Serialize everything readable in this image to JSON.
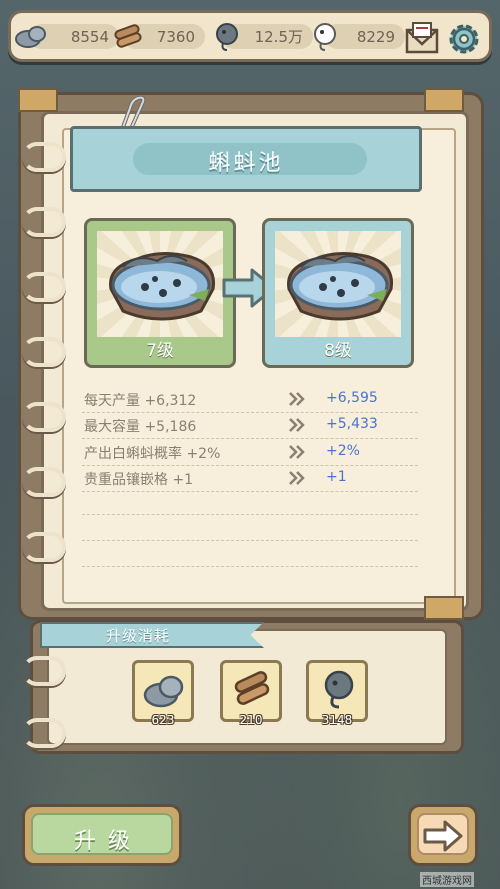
{
  "top_bar": {
    "stone_count": "8554",
    "wood_count": "7360",
    "tadpole_count": "12.5万",
    "ghost_count": "8229",
    "mail_icon": "mail-icon",
    "settings_icon": "gear-icon"
  },
  "building": {
    "title": "蝌蚪池",
    "current_level": "7级",
    "next_level": "8级"
  },
  "stats": [
    {
      "label": "每天产量 +6,312",
      "new": "+6,595"
    },
    {
      "label": "最大容量 +5,186",
      "new": "+5,433"
    },
    {
      "label": "产出白蝌蚪概率 +2%",
      "new": "+2%"
    },
    {
      "label": "贵重品镶嵌格 +1",
      "new": "+1"
    }
  ],
  "cost": {
    "title": "升级消耗",
    "items": [
      {
        "icon": "stone-icon",
        "value": "623"
      },
      {
        "icon": "wood-icon",
        "value": "210"
      },
      {
        "icon": "tadpole-icon",
        "value": "3148"
      }
    ]
  },
  "buttons": {
    "upgrade_label": "升级",
    "next_icon": "arrow-right-icon"
  },
  "watermark": "西城游戏网",
  "colors": {
    "accent_teal": "#a7d3d8",
    "paper": "#f3ead5",
    "stat_new_blue": "#4b73c9",
    "card_green": "#a9c98b",
    "card_blue": "#a7d3d8"
  }
}
